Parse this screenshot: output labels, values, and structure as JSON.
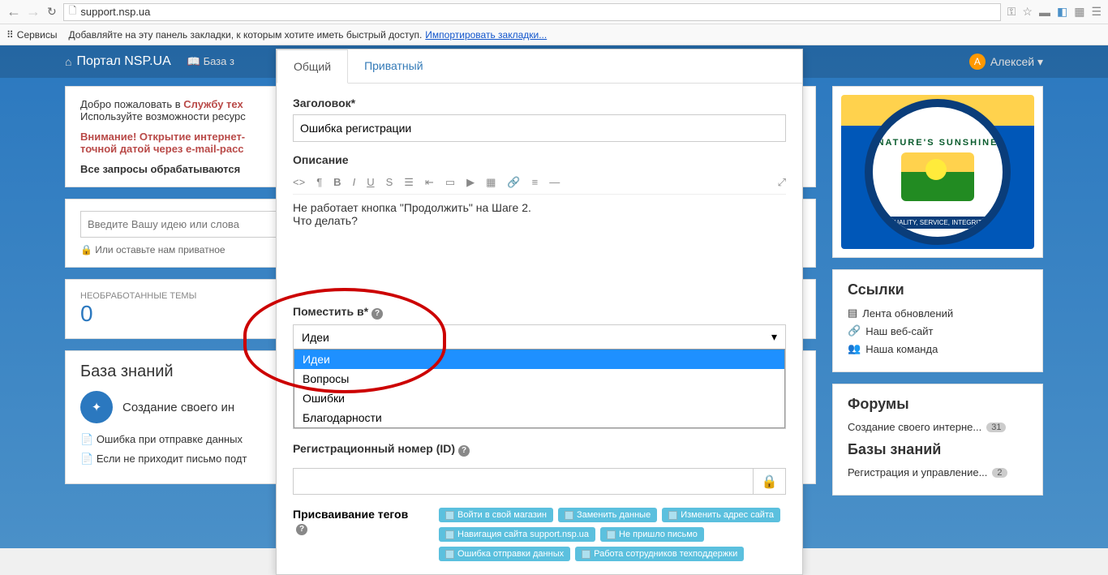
{
  "browser": {
    "url": "support.nsp.ua",
    "bookmark_services": "Сервисы",
    "bookmark_hint": "Добавляйте на эту панель закладки, к которым хотите иметь быстрый доступ.",
    "bookmark_import": "Импортировать закладки..."
  },
  "topnav": {
    "brand": "Портал NSP.UA",
    "kb": "База з",
    "user_initial": "А",
    "user_name": "Алексей"
  },
  "welcome": {
    "text1": "Добро пожаловать в ",
    "text2": "Службу тех",
    "text3": "Используйте возможности ресурс",
    "notice": "Внимание! Открытие интернет-\nточной датой через e-mail-расс",
    "processed": "Все запросы обрабатываются"
  },
  "search": {
    "placeholder": "Введите Вашу идею или слова",
    "private": "Или оставьте нам приватное"
  },
  "stats": {
    "label": "НЕОБРАБОТАННЫЕ ТЕМЫ",
    "value": "0"
  },
  "kb": {
    "title": "База знаний",
    "item1": "Создание своего ин",
    "link1": "Ошибка при отправке данных",
    "link2": "Если не приходит письмо подт"
  },
  "sidebar": {
    "logo_top": "NATURE'S SUNSHINE",
    "logo_bottom": "QUALITY, SERVICE, INTEGRITY",
    "links_title": "Ссылки",
    "link1": "Лента обновлений",
    "link2": "Наш веб-сайт",
    "link3": "Наша команда",
    "forums_title": "Форумы",
    "forum1": "Создание своего интерне...",
    "forum1_count": "31",
    "kb_title": "Базы знаний",
    "kb1": "Регистрация и управление...",
    "kb1_count": "2"
  },
  "modal": {
    "tab_public": "Общий",
    "tab_private": "Приватный",
    "title_label": "Заголовок*",
    "title_value": "Ошибка регистрации",
    "desc_label": "Описание",
    "desc_text": "Не работает кнопка \"Продолжить\" на Шаге 2.\nЧто делать?",
    "place_label": "Поместить в*",
    "select_current": "Идеи",
    "options": [
      "Идеи",
      "Вопросы",
      "Ошибки",
      "Благодарности"
    ],
    "reg_label": "Регистрационный номер (ID)",
    "tags_label": "Присваивание тегов",
    "tags": [
      "Войти в свой магазин",
      "Заменить данные",
      "Изменить адрес сайта",
      "Навигация сайта support.nsp.ua",
      "Не пришло письмо",
      "Ошибка отправки данных",
      "Работа сотрудников техподдержки"
    ]
  }
}
